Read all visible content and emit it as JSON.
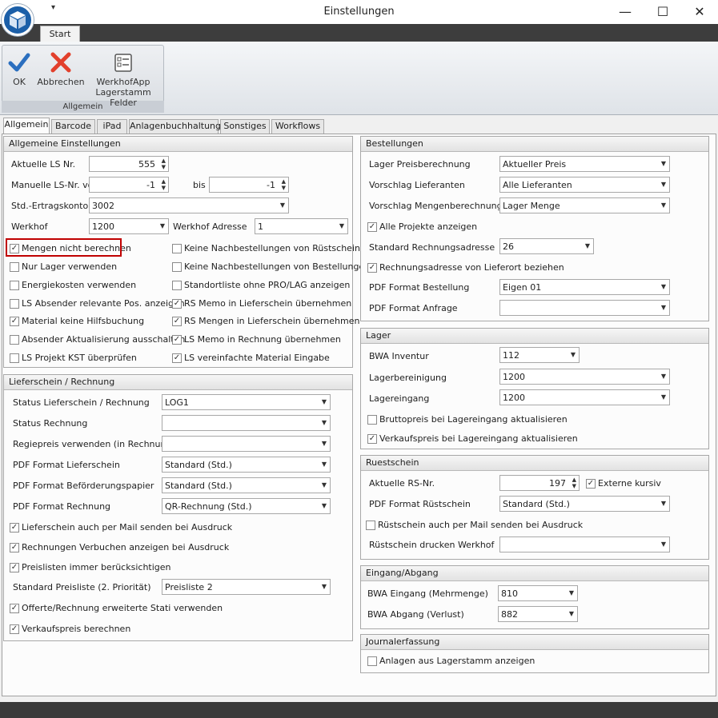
{
  "window": {
    "title": "Einstellungen",
    "minimize": "—",
    "maximize": "☐",
    "close": "✕"
  },
  "ribbon": {
    "tab": "Start",
    "group_label": "Allgemein",
    "ok": "OK",
    "cancel": "Abbrechen",
    "werkhof_line1": "WerkhofApp",
    "werkhof_line2": "Lagerstamm Felder"
  },
  "tabs": [
    "Allgemein",
    "Barcode",
    "iPad",
    "Anlagenbuchhaltung",
    "Sonstiges",
    "Workflows"
  ],
  "allgemein": {
    "title": "Allgemeine Einstellungen",
    "aktuelle_ls_label": "Aktuelle LS Nr.",
    "aktuelle_ls_value": "555",
    "manuelle_label": "Manuelle LS-Nr. von",
    "manuelle_von": "-1",
    "bis_label": "bis",
    "manuelle_bis": "-1",
    "ertrag_label": "Std.-Ertragskonto",
    "ertrag_value": "3002",
    "werkhof_label": "Werkhof",
    "werkhof_value": "1200",
    "werkhof_adresse_label": "Werkhof Adresse",
    "werkhof_adresse_value": "1",
    "checks_left": [
      {
        "label": "Mengen nicht berechnen",
        "checked": true
      },
      {
        "label": "Nur Lager verwenden",
        "checked": false
      },
      {
        "label": "Energiekosten verwenden",
        "checked": false
      },
      {
        "label": "LS Absender relevante Pos. anzeigen",
        "checked": false
      },
      {
        "label": "Material keine Hilfsbuchung",
        "checked": true
      },
      {
        "label": "Absender Aktualisierung ausschalten",
        "checked": false
      },
      {
        "label": "LS Projekt KST überprüfen",
        "checked": false
      }
    ],
    "checks_right": [
      {
        "label": "Keine Nachbestellungen von Rüstscheinen",
        "checked": false
      },
      {
        "label": "Keine Nachbestellungen von Bestellungen",
        "checked": false
      },
      {
        "label": "Standortliste ohne PRO/LAG anzeigen",
        "checked": false
      },
      {
        "label": "RS Memo in Lieferschein übernehmen",
        "checked": true
      },
      {
        "label": "RS Mengen in Lieferschein übernehmen",
        "checked": true
      },
      {
        "label": "LS Memo in Rechnung übernehmen",
        "checked": true
      },
      {
        "label": "LS vereinfachte Material Eingabe",
        "checked": true
      }
    ]
  },
  "lieferschein": {
    "title": "Lieferschein / Rechnung",
    "rows": [
      {
        "label": "Status Lieferschein / Rechnung",
        "value": "LOG1"
      },
      {
        "label": "Status Rechnung",
        "value": ""
      },
      {
        "label": "Regiepreis verwenden (in Rechnung)",
        "value": ""
      },
      {
        "label": "PDF Format Lieferschein",
        "value": "Standard (Std.)"
      },
      {
        "label": "PDF Format Beförderungspapier",
        "value": "Standard (Std.)"
      },
      {
        "label": "PDF Format Rechnung",
        "value": "QR-Rechnung (Std.)"
      }
    ],
    "checks": [
      {
        "label": "Lieferschein auch per Mail senden bei Ausdruck",
        "checked": true
      },
      {
        "label": "Rechnungen Verbuchen anzeigen bei Ausdruck",
        "checked": true
      },
      {
        "label": "Preislisten immer berücksichtigen",
        "checked": true
      }
    ],
    "preisliste_label": "Standard Preisliste (2. Priorität)",
    "preisliste_value": "Preisliste 2",
    "checks2": [
      {
        "label": "Offerte/Rechnung erweiterte Stati verwenden",
        "checked": true
      },
      {
        "label": "Verkaufspreis berechnen",
        "checked": true
      }
    ]
  },
  "bestellungen": {
    "title": "Bestellungen",
    "lager_preis_label": "Lager Preisberechnung",
    "lager_preis_value": "Aktueller Preis",
    "vorschlag_lief_label": "Vorschlag Lieferanten",
    "vorschlag_lief_value": "Alle Lieferanten",
    "vorschlag_menge_label": "Vorschlag Mengenberechnung",
    "vorschlag_menge_value": "Lager Menge",
    "alle_projekte": {
      "label": "Alle Projekte anzeigen",
      "checked": true
    },
    "std_rech_label": "Standard Rechnungsadresse",
    "std_rech_value": "26",
    "rech_lieferort": {
      "label": "Rechnungsadresse von Lieferort beziehen",
      "checked": true
    },
    "pdf_best_label": "PDF Format Bestellung",
    "pdf_best_value": "Eigen 01",
    "pdf_anf_label": "PDF Format Anfrage",
    "pdf_anf_value": ""
  },
  "lager": {
    "title": "Lager",
    "bwa_inv_label": "BWA Inventur",
    "bwa_inv_value": "112",
    "bereinigung_label": "Lagerbereinigung",
    "bereinigung_value": "1200",
    "eingang_label": "Lagereingang",
    "eingang_value": "1200",
    "brutto": {
      "label": "Bruttopreis bei Lagereingang aktualisieren",
      "checked": false
    },
    "verkauf": {
      "label": "Verkaufspreis bei Lagereingang aktualisieren",
      "checked": true
    }
  },
  "ruestschein": {
    "title": "Ruestschein",
    "rs_nr_label": "Aktuelle RS-Nr.",
    "rs_nr_value": "197",
    "extern": {
      "label": "Externe kursiv",
      "checked": true
    },
    "pdf_label": "PDF Format Rüstschein",
    "pdf_value": "Standard (Std.)",
    "mail": {
      "label": "Rüstschein auch per Mail senden bei Ausdruck",
      "checked": false
    },
    "werkhof_label": "Rüstschein drucken Werkhof",
    "werkhof_value": ""
  },
  "eingang": {
    "title": "Eingang/Abgang",
    "eingang_label": "BWA Eingang (Mehrmenge)",
    "eingang_value": "810",
    "abgang_label": "BWA Abgang (Verlust)",
    "abgang_value": "882"
  },
  "journal": {
    "title": "Journalerfassung",
    "anlagen": {
      "label": "Anlagen aus Lagerstamm anzeigen",
      "checked": false
    }
  }
}
